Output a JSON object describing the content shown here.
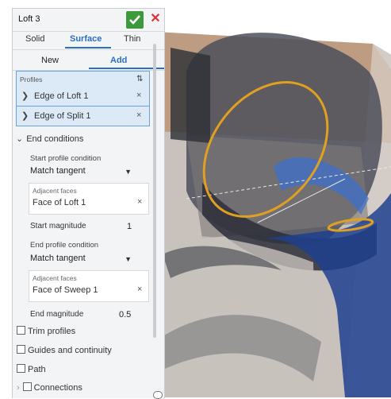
{
  "feature": {
    "title": "Loft 3",
    "ok_icon": "check-icon",
    "cancel_icon": "close-icon",
    "tabs": [
      "Solid",
      "Surface",
      "Thin"
    ],
    "active_tab": "Surface",
    "subtabs": [
      "New",
      "Add"
    ],
    "active_subtab": "Add"
  },
  "profiles": {
    "label": "Profiles",
    "items": [
      "Edge of Loft 1",
      "Edge of Split 1"
    ],
    "remove_symbol": "×",
    "expand_symbol": "❯",
    "sort_symbol": "⇅"
  },
  "end_conditions": {
    "header": "End conditions",
    "start_label": "Start profile condition",
    "start_value": "Match tangent",
    "start_adjacent_label": "Adjacent faces",
    "start_adjacent_value": "Face of Loft 1",
    "start_magnitude_label": "Start magnitude",
    "start_magnitude_value": "1",
    "end_label": "End profile condition",
    "end_value": "Match tangent",
    "end_adjacent_label": "Adjacent faces",
    "end_adjacent_value": "Face of Sweep 1",
    "end_magnitude_label": "End magnitude",
    "end_magnitude_value": "0.5"
  },
  "options": {
    "trim": "Trim profiles",
    "guides": "Guides and continuity",
    "path": "Path",
    "connections": "Connections"
  },
  "colors": {
    "accent": "#2a6fc0",
    "ok": "#3c9a3d",
    "cancel": "#d9323a",
    "selection": "#dceaf8",
    "profile_curve": "#e0a020",
    "model_blue": "#1f3f8f"
  }
}
